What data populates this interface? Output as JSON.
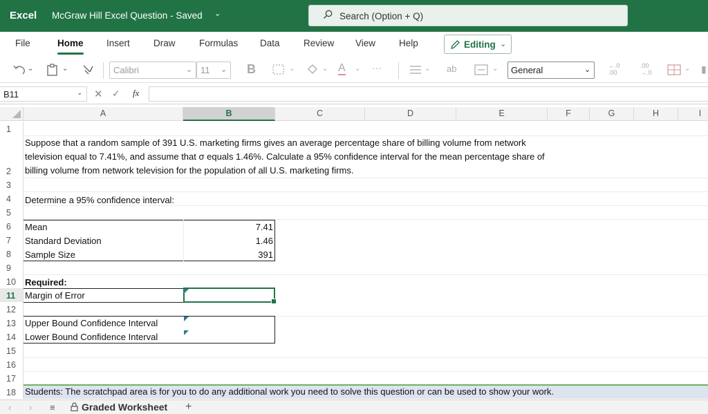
{
  "titlebar": {
    "app_name": "Excel",
    "document": "McGraw Hill Excel Question",
    "status": "Saved",
    "search_placeholder": "Search (Option + Q)",
    "accent": "#217346"
  },
  "menu": {
    "tabs": [
      "File",
      "Home",
      "Insert",
      "Draw",
      "Formulas",
      "Data",
      "Review",
      "View",
      "Help"
    ],
    "active_tab": "Home",
    "editing_label": "Editing"
  },
  "ribbon": {
    "font_name": "Calibri",
    "font_size": "11",
    "bold_label": "B",
    "number_format": "General",
    "more": "···"
  },
  "formula_bar": {
    "name_box": "B11",
    "fx_label": "fx",
    "formula": ""
  },
  "grid": {
    "columns": [
      "A",
      "B",
      "C",
      "D",
      "E",
      "F",
      "G",
      "H",
      "I"
    ],
    "selected_column": "B",
    "rows": [
      "1",
      "2",
      "3",
      "4",
      "5",
      "6",
      "7",
      "8",
      "9",
      "10",
      "11",
      "12",
      "13",
      "14",
      "15",
      "16",
      "17",
      "18"
    ],
    "selected_row": "11",
    "selected_cell": "B11"
  },
  "sheet": {
    "intro": "Suppose that a random sample of 391 U.S. marketing firms gives an average percentage share of billing volume from network television equal to 7.41%, and assume that σ equals 1.46%. Calculate a 95% confidence interval for the mean percentage share of billing volume from network television for the population of all U.S. marketing firms.",
    "prompt": "Determine a 95% confidence interval:",
    "inputs": [
      {
        "label": "Mean",
        "value": "7.41"
      },
      {
        "label": "Standard Deviation",
        "value": "1.46"
      },
      {
        "label": "Sample Size",
        "value": "391"
      }
    ],
    "required_label": "Required:",
    "margin_label": "Margin of Error",
    "upper_label": "Upper Bound Confidence Interval",
    "lower_label": "Lower Bound Confidence Interval",
    "scratchpad_note": "Students: The scratchpad area is for you to do any additional work you need to solve this question or can be used to show your work."
  },
  "sheet_tabs": {
    "active": "Graded Worksheet",
    "add": "+"
  }
}
